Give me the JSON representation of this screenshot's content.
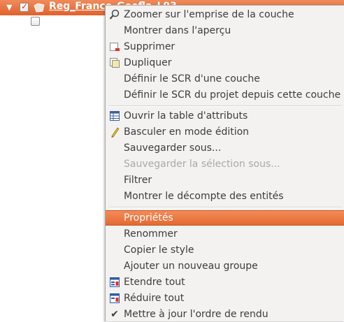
{
  "layer_tree": {
    "layer_name": "Reg_France_Geofla_L93",
    "expand_glyph": "▼",
    "checked": true
  },
  "context_menu": {
    "items": [
      {
        "label": "Zoomer sur l'emprise de la couche",
        "icon": "zoom-icon",
        "enabled": true
      },
      {
        "label": "Montrer dans l'aperçu",
        "icon": "",
        "enabled": true
      },
      {
        "label": "Supprimer",
        "icon": "remove-layer-icon",
        "enabled": true
      },
      {
        "label": "Dupliquer",
        "icon": "duplicate-layer-icon",
        "enabled": true
      },
      {
        "label": "Définir le SCR d'une couche",
        "icon": "",
        "enabled": true
      },
      {
        "label": "Définir le SCR du projet depuis cette couche",
        "icon": "",
        "enabled": true
      },
      {
        "label": "Ouvrir la table d'attributs",
        "icon": "attribute-table-icon",
        "enabled": true
      },
      {
        "label": "Basculer en mode édition",
        "icon": "pencil-icon",
        "enabled": true
      },
      {
        "label": "Sauvegarder sous...",
        "icon": "",
        "enabled": true
      },
      {
        "label": "Sauvegarder la sélection sous...",
        "icon": "",
        "enabled": false
      },
      {
        "label": "Filtrer",
        "icon": "",
        "enabled": true
      },
      {
        "label": "Montrer le décompte des entités",
        "icon": "",
        "enabled": true
      },
      {
        "label": "Propriétés",
        "icon": "",
        "enabled": true,
        "highlighted": true
      },
      {
        "label": "Renommer",
        "icon": "",
        "enabled": true
      },
      {
        "label": "Copier le style",
        "icon": "",
        "enabled": true
      },
      {
        "label": "Ajouter un nouveau groupe",
        "icon": "",
        "enabled": true
      },
      {
        "label": "Etendre tout",
        "icon": "expand-tree-icon",
        "enabled": true
      },
      {
        "label": "Réduire tout",
        "icon": "collapse-tree-icon",
        "enabled": true
      },
      {
        "label": "Mettre à jour l'ordre de rendu",
        "icon": "checkmark-icon",
        "enabled": true,
        "checked": true
      }
    ]
  },
  "colors": {
    "highlight": "#e8703a",
    "menu_background": "#f3f2f1",
    "disabled_text": "#a9a9a9"
  }
}
